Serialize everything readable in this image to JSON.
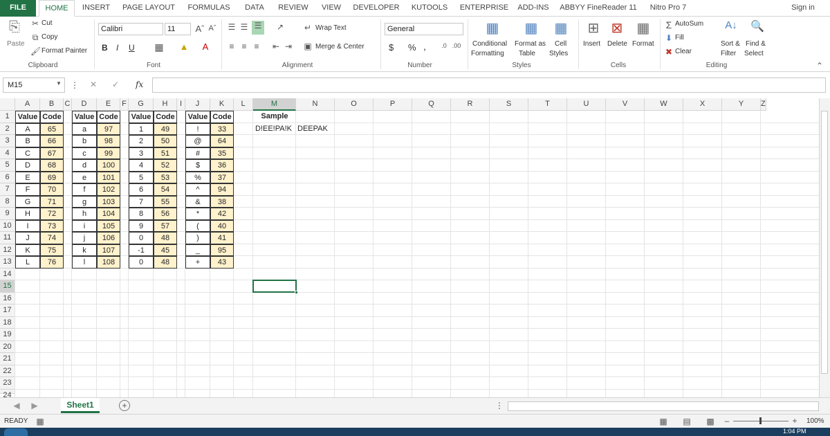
{
  "tabs": [
    "FILE",
    "HOME",
    "INSERT",
    "PAGE LAYOUT",
    "FORMULAS",
    "DATA",
    "REVIEW",
    "VIEW",
    "DEVELOPER",
    "KUTOOLS",
    "ENTERPRISE",
    "ADD-INS",
    "ABBYY FineReader 11",
    "Nitro Pro 7"
  ],
  "sign_in": "Sign in",
  "clipboard": {
    "paste": "Paste",
    "cut": "Cut",
    "copy": "Copy",
    "format_painter": "Format Painter",
    "label": "Clipboard"
  },
  "font": {
    "name": "Calibri",
    "size": "11",
    "bold": "B",
    "italic": "I",
    "underline": "U",
    "label": "Font"
  },
  "alignment": {
    "wrap": "Wrap Text",
    "merge": "Merge & Center",
    "label": "Alignment"
  },
  "number": {
    "format": "General",
    "currency": "$",
    "percent": "%",
    "comma": ",",
    "label": "Number"
  },
  "styles": {
    "conditional": "Conditional",
    "conditional2": "Formatting",
    "format_table": "Format as",
    "format_table2": "Table",
    "cell_styles": "Cell",
    "cell_styles2": "Styles",
    "label": "Styles"
  },
  "cells": {
    "insert": "Insert",
    "delete": "Delete",
    "format": "Format",
    "label": "Cells"
  },
  "editing": {
    "autosum": "AutoSum",
    "fill": "Fill",
    "clear": "Clear",
    "sort": "Sort &",
    "sort2": "Filter",
    "find": "Find &",
    "find2": "Select",
    "label": "Editing"
  },
  "formula_bar": {
    "name_box": "M15",
    "fx": "fx",
    "value": ""
  },
  "columns": [
    "A",
    "B",
    "C",
    "D",
    "E",
    "F",
    "G",
    "H",
    "I",
    "J",
    "K",
    "L",
    "M",
    "N",
    "O",
    "P",
    "Q",
    "R",
    "S",
    "T",
    "U",
    "V",
    "W",
    "X",
    "Y",
    "Z"
  ],
  "rows": [
    "1",
    "2",
    "3",
    "4",
    "5",
    "6",
    "7",
    "8",
    "9",
    "10",
    "11",
    "12",
    "13",
    "14",
    "15",
    "16",
    "17",
    "18",
    "19",
    "20",
    "21",
    "22",
    "23",
    "24"
  ],
  "table_header": {
    "value": "Value",
    "code": "Code"
  },
  "tables": [
    {
      "values": [
        "A",
        "B",
        "C",
        "D",
        "E",
        "F",
        "G",
        "H",
        "I",
        "J",
        "K",
        "L"
      ],
      "codes": [
        "65",
        "66",
        "67",
        "68",
        "69",
        "70",
        "71",
        "72",
        "73",
        "74",
        "75",
        "76"
      ]
    },
    {
      "values": [
        "a",
        "b",
        "c",
        "d",
        "e",
        "f",
        "g",
        "h",
        "i",
        "j",
        "k",
        "l"
      ],
      "codes": [
        "97",
        "98",
        "99",
        "100",
        "101",
        "102",
        "103",
        "104",
        "105",
        "106",
        "107",
        "108"
      ]
    },
    {
      "values": [
        "1",
        "2",
        "3",
        "4",
        "5",
        "6",
        "7",
        "8",
        "9",
        "0",
        "-1",
        "0"
      ],
      "codes": [
        "49",
        "50",
        "51",
        "52",
        "53",
        "54",
        "55",
        "56",
        "57",
        "48",
        "45",
        "48"
      ]
    },
    {
      "values": [
        "!",
        "@",
        "#",
        "$",
        "%",
        "^",
        "&",
        "*",
        "(",
        ")",
        "_",
        "+"
      ],
      "codes": [
        "33",
        "64",
        "35",
        "36",
        "37",
        "94",
        "38",
        "42",
        "40",
        "41",
        "95",
        "43"
      ]
    }
  ],
  "sample": {
    "header": "Sample",
    "input": "D!EE!PA!K",
    "output": "DEEPAK"
  },
  "sheet_tab": "Sheet1",
  "status": {
    "ready": "READY",
    "zoom": "100%"
  },
  "time": "1:04 PM",
  "colors": {
    "accent": "#217346",
    "table_fill": "#fff2cc",
    "header_selected": "#d2d2d2"
  }
}
